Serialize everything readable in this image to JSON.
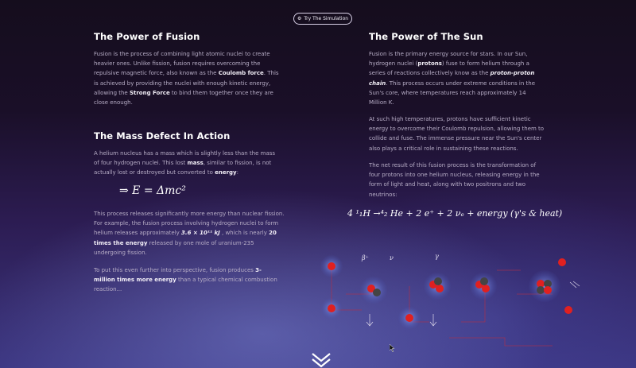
{
  "header": {
    "button_label": "Try The Simulation",
    "button_icon": "gear-icon"
  },
  "left": {
    "fusion": {
      "title": "The Power of Fusion",
      "p1_a": "Fusion is the process of combining light atomic nuclei to create heavier ones. Unlike fission, fusion requires overcoming the repulsive magnetic force, also known as the ",
      "p1_b": "Coulomb force",
      "p1_c": ". This is achieved by providing the nuclei with enough kinetic energy, allowing the ",
      "p1_d": "Strong Force",
      "p1_e": " to bind them together once they are close enough."
    },
    "mass": {
      "title": "The Mass Defect In Action",
      "p1_a": "A helium nucleus has a mass which is slightly less than the mass of four hydrogen nuclei. This lost ",
      "p1_b": "mass",
      "p1_c": ", similar to fission, is not actually lost or destroyed but converted to ",
      "p1_d": "energy",
      "p1_e": ":",
      "equation": "⇒ E = Δmc²",
      "p2_a": "This process releases significantly more energy than nuclear fission. For example, the fusion process involving hydrogen nuclei to form helium releases approximately ",
      "p2_b": "3.6 × 10¹¹ kJ",
      "p2_c": " , which is nearly ",
      "p2_d": "20 times the energy",
      "p2_e": " released by one mole of uranium-235 undergoing fission.",
      "p3_a": "To put this even further into perspective, fusion produces ",
      "p3_b": "3-million times more energy",
      "p3_c": " than a typical chemical combustion reaction..."
    }
  },
  "right": {
    "sun": {
      "title": "The Power of The Sun",
      "p1_a": "Fusion is the primary energy source for stars. In our Sun, hydrogen nuclei (",
      "p1_b": "protons",
      "p1_c": ") fuse to form helium through a series of reactions collectively know as the ",
      "p1_d": "proton-proton chain",
      "p1_e": ". This process occurs under extreme conditions in the Sun's core, where temperatures reach approximately 14 Million K.",
      "p2": "At such high temperatures, protons have sufficient kinetic energy to overcome their Coulomb repulsion, allowing them to collide and fuse. The immense pressure near the Sun's center also plays a critical role in sustaining these reactions.",
      "p3": "The net result of this fusion process is the transformation of four protons into one helium nucleus, releasing energy in the form of light and heat, along with two positrons and two neutrinos:",
      "equation": "4 ¹₁H →⁴₂ He + 2 e⁺ + 2 νₑ + energy (γ's & heat)"
    }
  },
  "diagram": {
    "labels": [
      "β⁺",
      "ν",
      "γ"
    ]
  },
  "footer": {
    "scroll_icon": "chevron-down-icon"
  }
}
